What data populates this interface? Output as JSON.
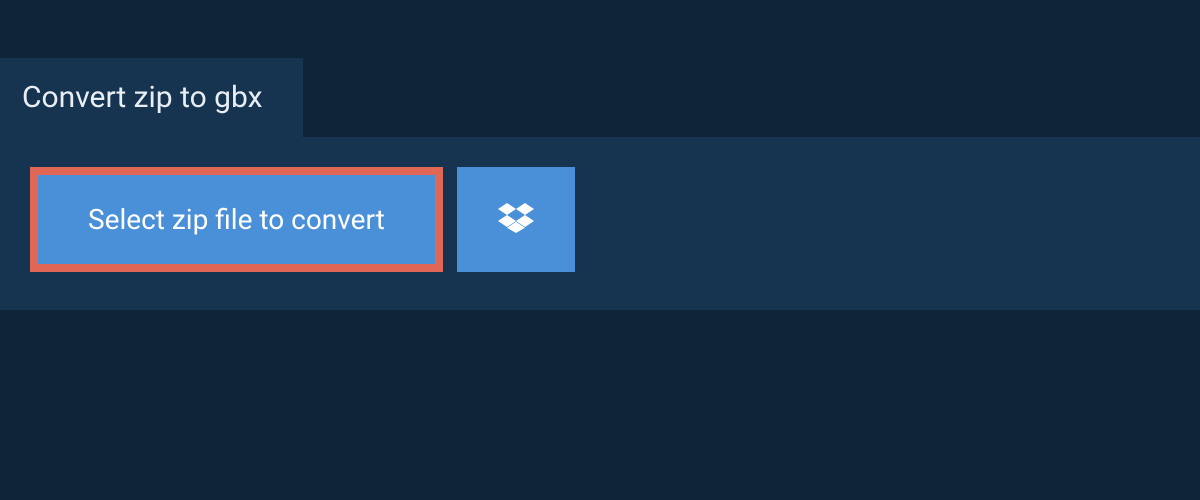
{
  "tab": {
    "title": "Convert zip to gbx"
  },
  "actions": {
    "select_file_label": "Select zip file to convert",
    "dropbox_icon": "dropbox"
  },
  "colors": {
    "background": "#0f2438",
    "panel": "#163450",
    "button_bg": "#4a90d9",
    "button_border_highlight": "#e06656",
    "text_light": "#e8eef3",
    "text_button": "#ffffff"
  }
}
